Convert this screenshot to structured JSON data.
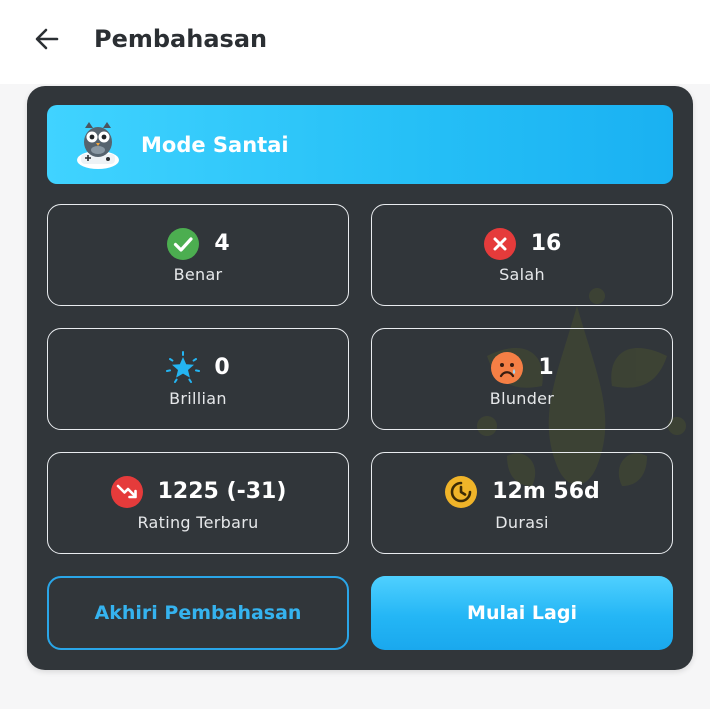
{
  "header": {
    "title": "Pembahasan",
    "back_icon": "arrow-left-icon"
  },
  "mode": {
    "label": "Mode Santai",
    "icon": "owl-gamepad-mascot"
  },
  "stats": [
    {
      "value": "4",
      "label": "Benar",
      "icon": "check-circle-icon",
      "color": "#4cae50"
    },
    {
      "value": "16",
      "label": "Salah",
      "icon": "x-circle-icon",
      "color": "#e53b3b"
    },
    {
      "value": "0",
      "label": "Brillian",
      "icon": "star-burst-icon",
      "color": "#24b5f2"
    },
    {
      "value": "1",
      "label": "Blunder",
      "icon": "sad-face-icon",
      "color": "#f57f45"
    },
    {
      "value": "1225 (-31)",
      "label": "Rating Terbaru",
      "icon": "trend-down-icon",
      "color": "#e53b3b"
    },
    {
      "value": "12m 56d",
      "label": "Durasi",
      "icon": "clock-icon",
      "color": "#f0b429"
    }
  ],
  "actions": {
    "end_label": "Akhiri Pembahasan",
    "restart_label": "Mulai Lagi"
  },
  "colors": {
    "accent": "#1ab1f2",
    "card_bg": "#31363a"
  }
}
